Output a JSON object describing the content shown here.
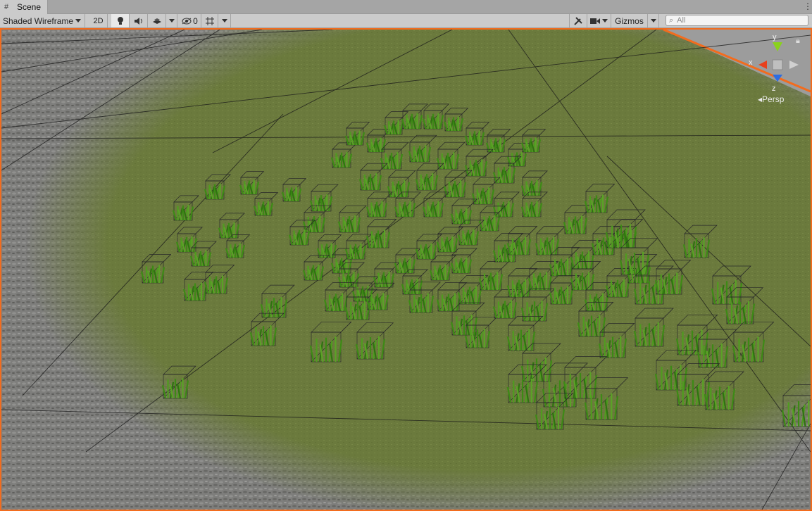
{
  "tab": {
    "title": "Scene",
    "icon": "grid-icon"
  },
  "toolbar": {
    "draw_mode": "Shaded Wireframe",
    "mode_2d": "2D",
    "hidden_count": "0",
    "gizmos": "Gizmos",
    "search_placeholder": "All"
  },
  "gizmo": {
    "x": "x",
    "y": "y",
    "z": "z",
    "projection": "Persp"
  },
  "colors": {
    "accent_border": "#f26c1e",
    "grass_green": "#3f8e1a",
    "ground_green": "#6f7e3e"
  }
}
